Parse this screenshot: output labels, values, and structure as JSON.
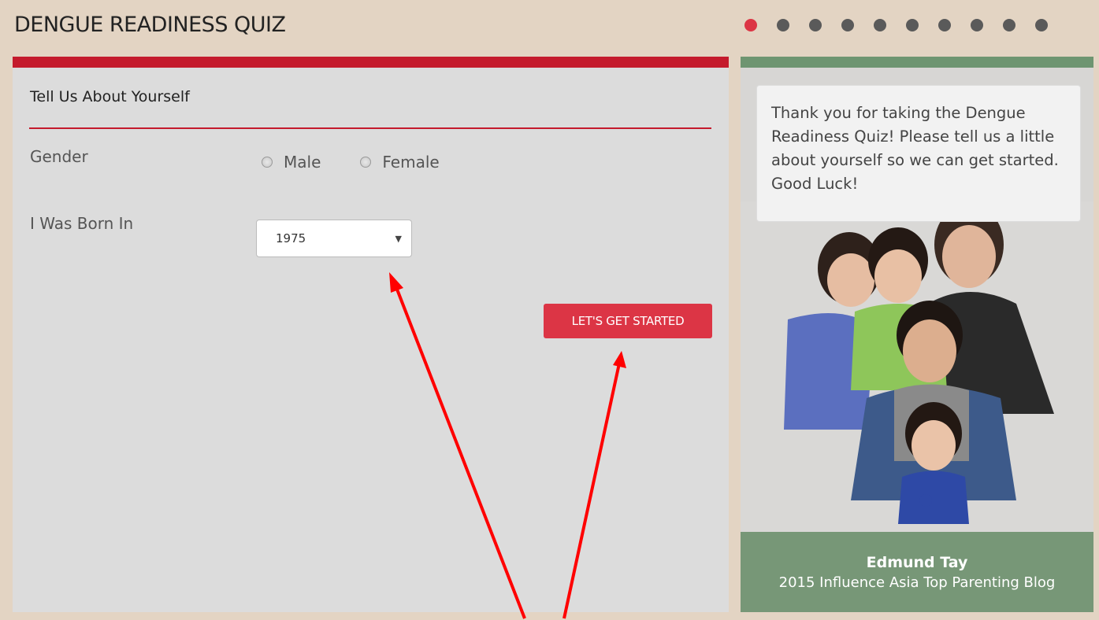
{
  "header": {
    "title": "DENGUE READINESS QUIZ",
    "progress": {
      "total_steps": 10,
      "current_step": 1
    }
  },
  "form": {
    "section_title": "Tell Us About Yourself",
    "gender_label": "Gender",
    "gender_options": [
      "Male",
      "Female"
    ],
    "born_label": "I Was Born In",
    "born_value": "1975",
    "submit_label": "LET'S GET STARTED"
  },
  "sidebar": {
    "message": "Thank you for taking the Dengue Readiness Quiz! Please tell us a little about yourself so we can get started. Good Luck!",
    "caption_name": "Edmund Tay",
    "caption_subtitle": "2015 Influence Asia Top Parenting Blog"
  },
  "colors": {
    "accent_red": "#dc3545",
    "header_bar_red": "#c41a2c",
    "sidebar_green": "#779777",
    "page_background": "#e3d4c3",
    "annotation_arrow": "#ff0000"
  }
}
